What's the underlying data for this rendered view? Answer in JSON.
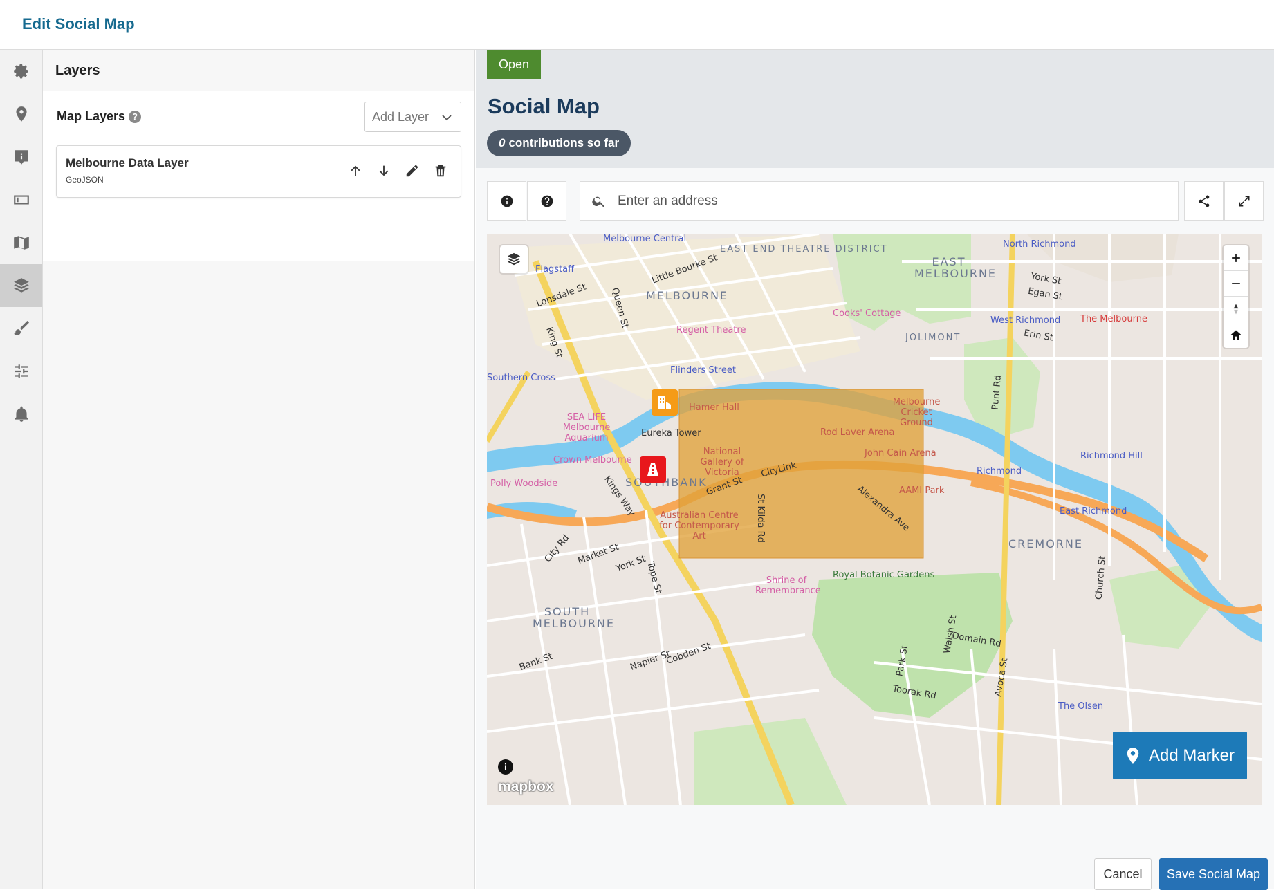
{
  "header": {
    "title": "Edit Social Map"
  },
  "rail": {
    "items": [
      {
        "icon": "gear-icon"
      },
      {
        "icon": "location-pin-icon"
      },
      {
        "icon": "info-marker-icon"
      },
      {
        "icon": "ticket-icon"
      },
      {
        "icon": "map-icon"
      },
      {
        "icon": "layers-icon",
        "active": true
      },
      {
        "icon": "paintbrush-icon"
      },
      {
        "icon": "sliders-icon"
      },
      {
        "icon": "bell-icon"
      }
    ]
  },
  "layers_panel": {
    "title": "Layers",
    "map_layers_label": "Map Layers",
    "help_glyph": "?",
    "add_layer_placeholder": "Add Layer",
    "layer": {
      "name": "Melbourne Data Layer",
      "type": "GeoJSON"
    }
  },
  "social_map": {
    "status_badge": "Open",
    "title": "Social Map",
    "contributions_count": "0",
    "contributions_text": "contributions so far",
    "search_placeholder": "Enter an address",
    "add_marker_label": "Add Marker",
    "map_attribution": "mapbox",
    "map_labels": {
      "districts": [
        "EAST END THEATRE DISTRICT",
        "MELBOURNE",
        "EAST MELBOURNE",
        "SOUTHBANK",
        "SOUTH MELBOURNE",
        "CREMORNE",
        "JOLIMONT"
      ],
      "transit": [
        "Melbourne Central",
        "Flagstaff",
        "Flinders Street",
        "Southern Cross",
        "North Richmond",
        "West Richmond",
        "Richmond",
        "Richmond Hill",
        "East Richmond"
      ],
      "poi": [
        "Cooks' Cottage",
        "Regent Theatre",
        "SEA LIFE Melbourne Aquarium",
        "Crown Melbourne",
        "Polly Woodside",
        "Eureka Tower",
        "Hamer Hall",
        "National Gallery of Victoria",
        "Australian Centre for Contemporary Art",
        "Shrine of Remembrance",
        "Royal Botanic Gardens",
        "Melbourne Cricket Ground",
        "Rod Laver Arena",
        "John Cain Arena",
        "AAMI Park",
        "The Melbourne Clinic",
        "The Olsen"
      ],
      "streets": [
        "Lonsdale St",
        "Little Bourke St",
        "Queen St",
        "King St",
        "Kings Way",
        "City Rd",
        "Market St",
        "York St",
        "Tope St",
        "Grant St",
        "St Kilda Rd",
        "CityLink",
        "Alexandra Ave",
        "Bank St",
        "Napier St",
        "Cobden St",
        "Park St",
        "Walsh St",
        "Domain Rd",
        "Toorak Rd",
        "Avoca St",
        "Punt Rd",
        "Church St",
        "York St",
        "Egan St",
        "Erin St"
      ]
    }
  },
  "footer": {
    "cancel_label": "Cancel",
    "save_label": "Save Social Map"
  }
}
